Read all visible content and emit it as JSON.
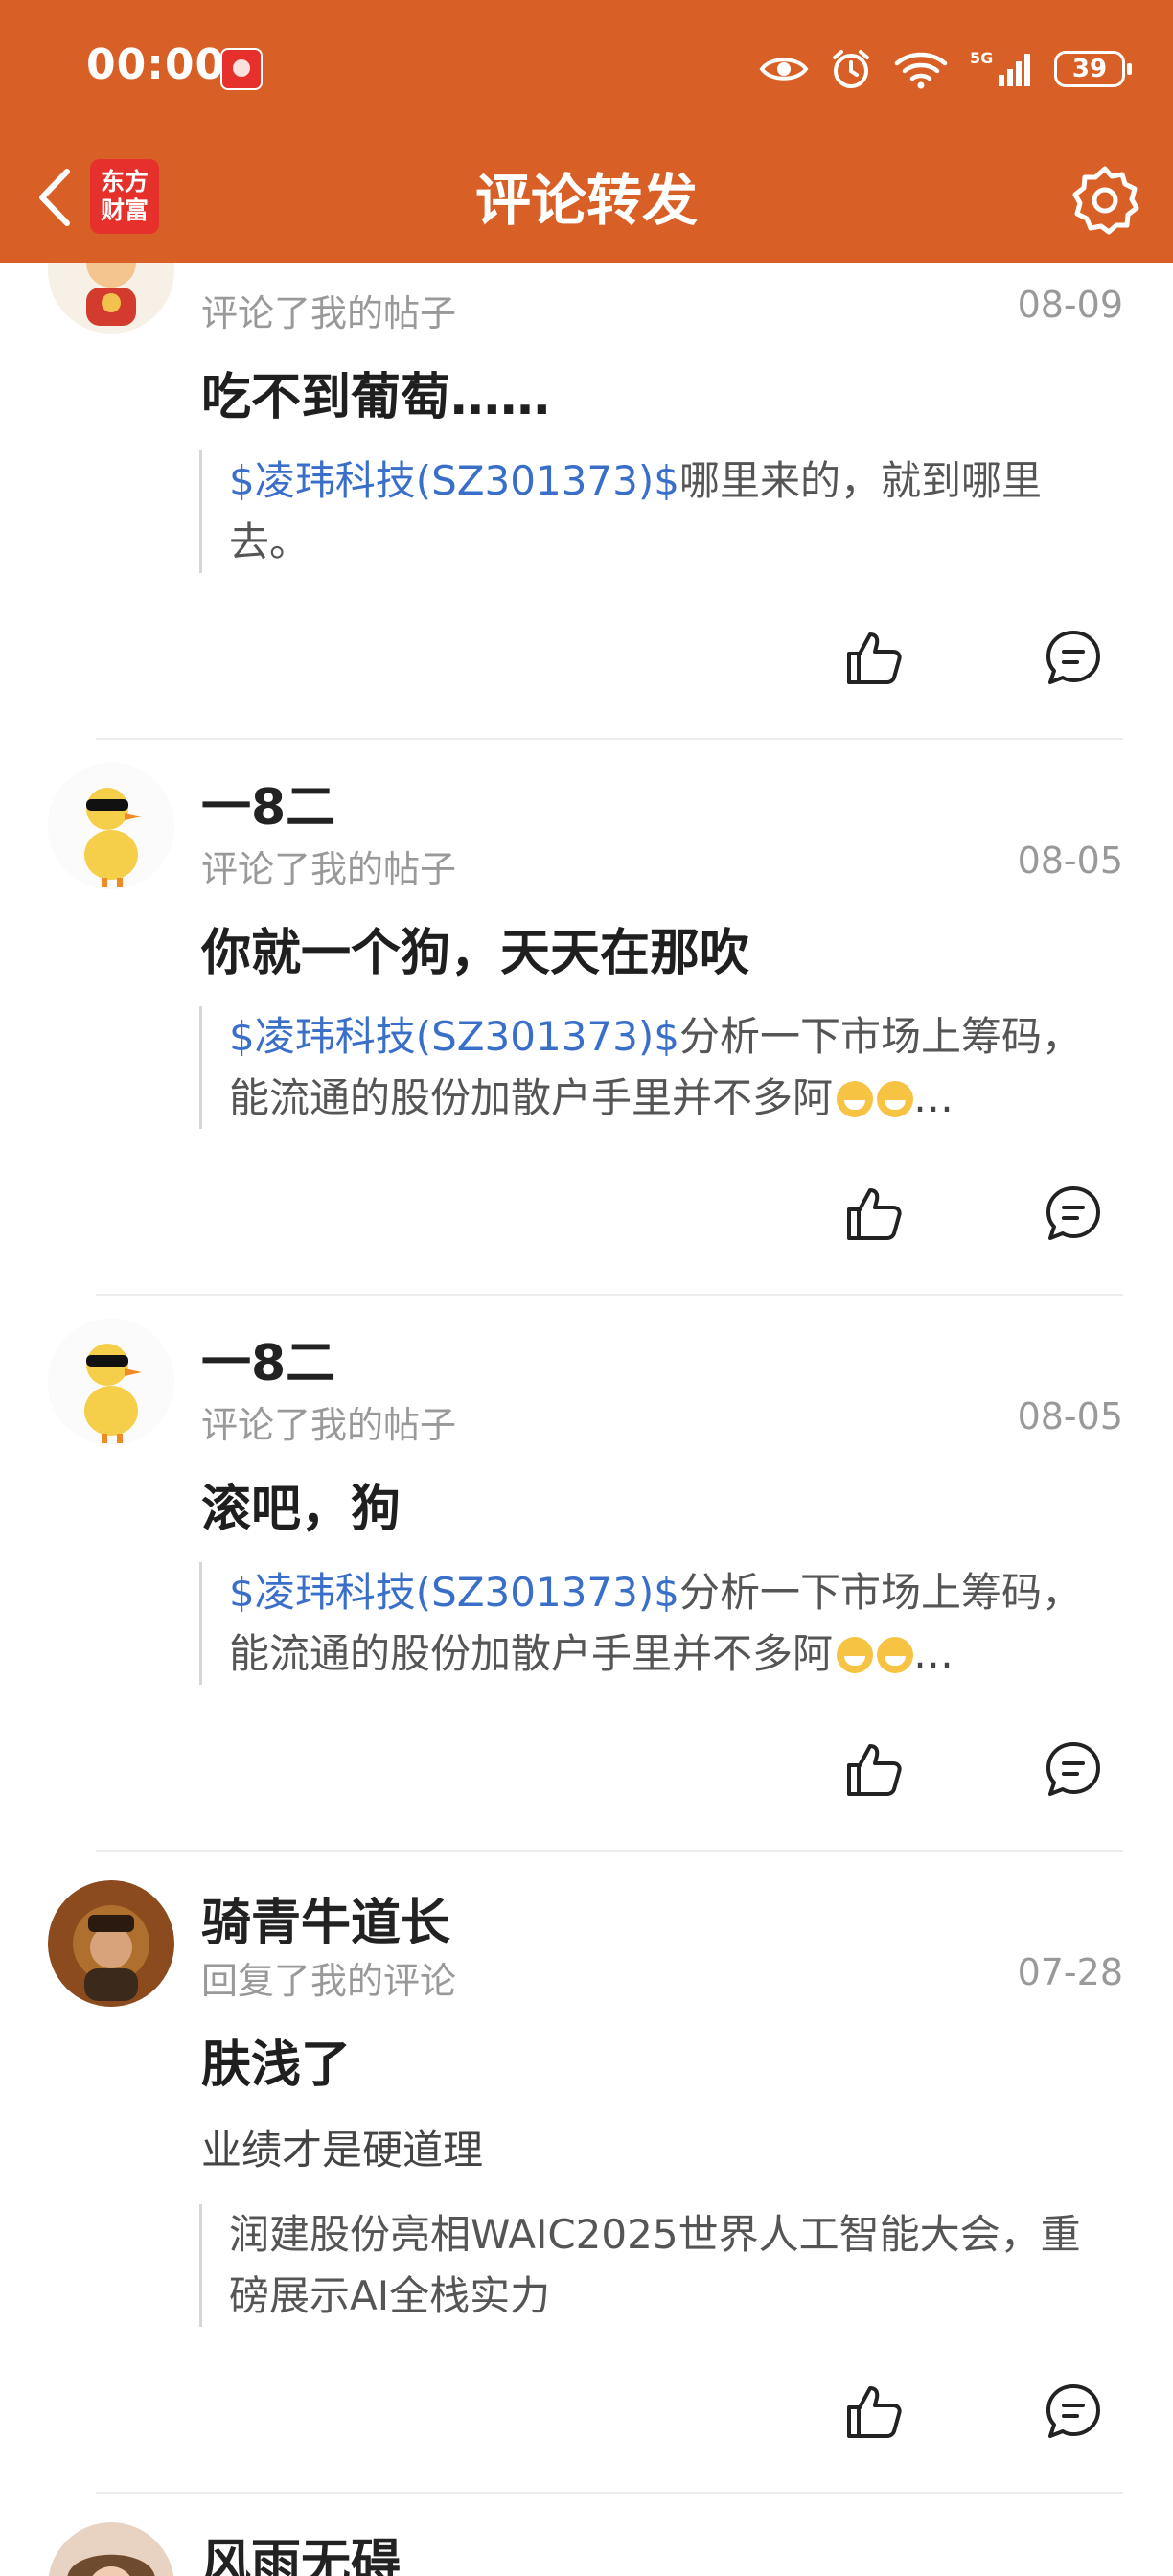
{
  "status_bar": {
    "time": "00:00",
    "battery": "39"
  },
  "nav": {
    "title": "评论转发",
    "logo_line1": "东方",
    "logo_line2": "财富"
  },
  "items": [
    {
      "username": "",
      "action": "评论了我的帖子",
      "date": "08-09",
      "comment": "吃不到葡萄……",
      "quote_link": "$凌玮科技(SZ301373)$",
      "quote_text": "哪里来的，就到哪里去。"
    },
    {
      "username": "一8二",
      "action": "评论了我的帖子",
      "date": "08-05",
      "comment": "你就一个狗，天天在那吹",
      "quote_link": "$凌玮科技(SZ301373)$",
      "quote_text": "分析一下市场上筹码，能流通的股份加散户手里并不多阿"
    },
    {
      "username": "一8二",
      "action": "评论了我的帖子",
      "date": "08-05",
      "comment": "滚吧，狗",
      "quote_link": "$凌玮科技(SZ301373)$",
      "quote_text": "分析一下市场上筹码，能流通的股份加散户手里并不多阿"
    },
    {
      "username": "骑青牛道长",
      "action": "回复了我的评论",
      "date": "07-28",
      "comment": "肤浅了",
      "subtext": "业绩才是硬道理",
      "quote_text": "润建股份亮相WAIC2025世界人工智能大会，重磅展示AI全栈实力"
    },
    {
      "username": "风雨无碍"
    }
  ],
  "colors": {
    "header": "#D85F26",
    "link": "#3A6FC9"
  }
}
